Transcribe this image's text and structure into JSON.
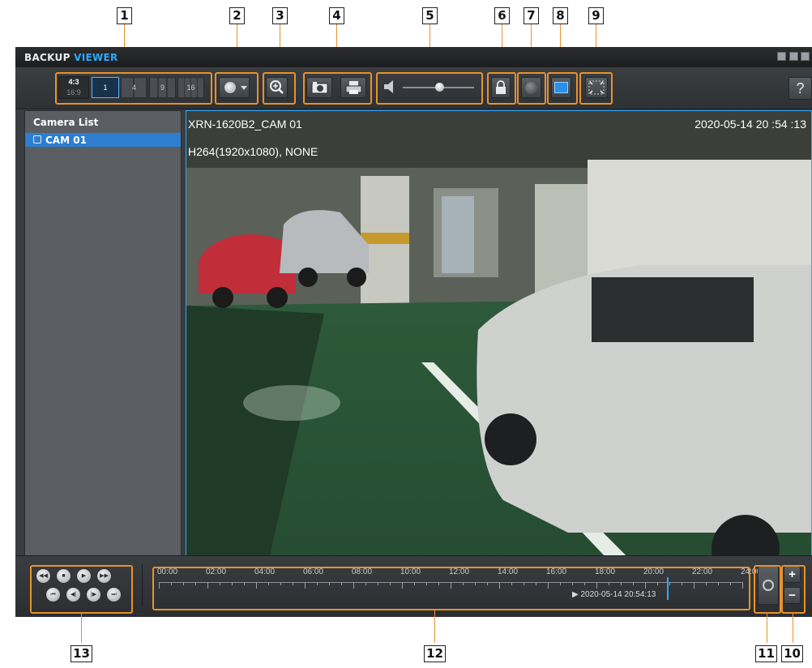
{
  "window": {
    "title_part1": "BACKUP",
    "title_part2": "VIEWER"
  },
  "toolbar": {
    "aspect_43": "4:3",
    "aspect_169": "16:9",
    "layouts": [
      "1",
      "4",
      "9",
      "16"
    ],
    "help": "?"
  },
  "sidebar": {
    "title": "Camera List",
    "cameras": [
      "CAM 01"
    ]
  },
  "video": {
    "camera_name": "XRN-1620B2_CAM 01",
    "timestamp": "2020-05-14 20 :54 :13",
    "codec_info": "H264(1920x1080), NONE"
  },
  "timeline": {
    "hours": [
      "00:00",
      "02:00",
      "04:00",
      "06:00",
      "08:00",
      "10:00",
      "12:00",
      "14:00",
      "16:00",
      "18:00",
      "20:00",
      "22:00",
      "24:00"
    ],
    "cursor_label": "2020-05-14 20:54:13",
    "cursor_time_fraction": 0.871
  },
  "callouts": [
    "1",
    "2",
    "3",
    "4",
    "5",
    "6",
    "7",
    "8",
    "9",
    "10",
    "11",
    "12",
    "13"
  ],
  "colors": {
    "accent": "#2ea8ff",
    "callout_box": "#e8912c",
    "selected_row": "#2d7ed1"
  },
  "icons": [
    "minimize-icon",
    "maximize-icon",
    "close-icon",
    "camera-icon",
    "capture-icon",
    "print-icon",
    "speaker-icon",
    "zoom-in-icon",
    "lock-icon",
    "record-icon",
    "display-icon",
    "fullscreen-icon",
    "help-icon",
    "rewind-icon",
    "stop-icon",
    "play-icon",
    "forward-icon",
    "skip-start-icon",
    "step-back-icon",
    "step-forward-icon",
    "skip-end-icon",
    "timeline-zoom-in-icon",
    "timeline-zoom-out-icon",
    "sync-icon"
  ]
}
